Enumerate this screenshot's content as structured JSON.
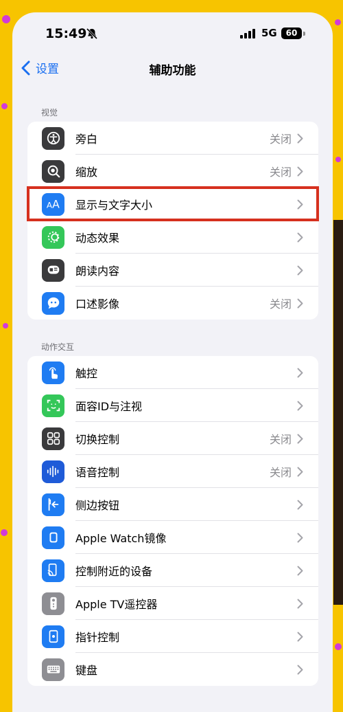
{
  "status": {
    "time": "15:49",
    "network": "5G",
    "battery": "60"
  },
  "nav": {
    "back_label": "设置",
    "title": "辅助功能"
  },
  "sections": [
    {
      "header": "视觉",
      "items": [
        {
          "label": "旁白",
          "value": "关闭",
          "icon": "voiceover-icon",
          "color": "#3a3a3c"
        },
        {
          "label": "缩放",
          "value": "关闭",
          "icon": "zoom-icon",
          "color": "#3a3a3c"
        },
        {
          "label": "显示与文字大小",
          "value": "",
          "icon": "text-size-icon",
          "color": "#1f7cf2"
        },
        {
          "label": "动态效果",
          "value": "",
          "icon": "motion-icon",
          "color": "#34c759"
        },
        {
          "label": "朗读内容",
          "value": "",
          "icon": "spoken-content-icon",
          "color": "#3a3a3c"
        },
        {
          "label": "口述影像",
          "value": "关闭",
          "icon": "audio-description-icon",
          "color": "#1f7cf2"
        }
      ]
    },
    {
      "header": "动作交互",
      "items": [
        {
          "label": "触控",
          "value": "",
          "icon": "touch-icon",
          "color": "#1f7cf2"
        },
        {
          "label": "面容ID与注视",
          "value": "",
          "icon": "face-id-icon",
          "color": "#34c759"
        },
        {
          "label": "切换控制",
          "value": "关闭",
          "icon": "switch-control-icon",
          "color": "#3a3a3c"
        },
        {
          "label": "语音控制",
          "value": "关闭",
          "icon": "voice-control-icon",
          "color": "#1f5bd8"
        },
        {
          "label": "侧边按钮",
          "value": "",
          "icon": "side-button-icon",
          "color": "#1f7cf2"
        },
        {
          "label": "Apple Watch镜像",
          "value": "",
          "icon": "watch-mirroring-icon",
          "color": "#1f7cf2"
        },
        {
          "label": "控制附近的设备",
          "value": "",
          "icon": "nearby-devices-icon",
          "color": "#1f7cf2"
        },
        {
          "label": "Apple TV遥控器",
          "value": "",
          "icon": "tv-remote-icon",
          "color": "#8e8e93"
        },
        {
          "label": "指针控制",
          "value": "",
          "icon": "pointer-control-icon",
          "color": "#1f7cf2"
        },
        {
          "label": "键盘",
          "value": "",
          "icon": "keyboard-icon",
          "color": "#8e8e93"
        }
      ]
    }
  ],
  "colors": {
    "accent": "#1a6ff0",
    "highlight_border": "#d6301e",
    "background": "#f7c400"
  }
}
